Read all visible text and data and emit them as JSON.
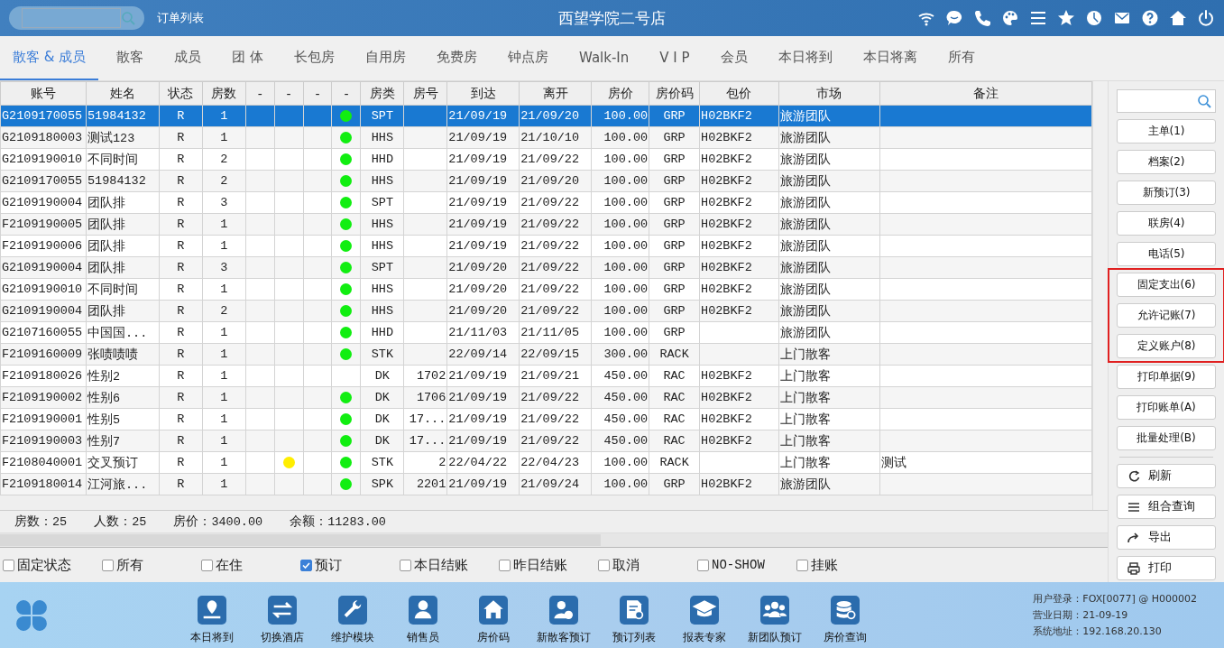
{
  "top_bar": {
    "page_label": "订单列表",
    "title": "西望学院二号店"
  },
  "tabs": [
    {
      "label": "散客 & 成员",
      "selected": true
    },
    {
      "label": "散客",
      "selected": false
    },
    {
      "label": "成员",
      "selected": false
    },
    {
      "label": "团 体",
      "selected": false
    },
    {
      "label": "长包房",
      "selected": false
    },
    {
      "label": "自用房",
      "selected": false
    },
    {
      "label": "免费房",
      "selected": false
    },
    {
      "label": "钟点房",
      "selected": false
    },
    {
      "label": "Walk-In",
      "selected": false
    },
    {
      "label": "V I P",
      "selected": false
    },
    {
      "label": "会员",
      "selected": false
    },
    {
      "label": "本日将到",
      "selected": false
    },
    {
      "label": "本日将离",
      "selected": false
    },
    {
      "label": "所有",
      "selected": false
    }
  ],
  "table": {
    "columns": [
      "账号",
      "姓名",
      "状态",
      "房数",
      "-",
      "-",
      "-",
      "-",
      "房类",
      "房号",
      "到达",
      "离开",
      "房价",
      "房价码",
      "包价",
      "市场",
      "备注"
    ],
    "rows": [
      {
        "account": "G2109170055",
        "name": "51984132",
        "status": "R",
        "rooms": "1",
        "dot": {
          "color": "#11ee11"
        },
        "room_type": "SPT",
        "arrival": "21/09/19",
        "departure": "21/09/20",
        "rate": "100.00",
        "rate_code": "GRP",
        "package": "H02BKF2",
        "market": "旅游团队",
        "selected": true
      },
      {
        "account": "G2109180003",
        "name": "测试123",
        "status": "R",
        "rooms": "1",
        "dot": {
          "color": "#11ee11"
        },
        "room_type": "HHS",
        "arrival": "21/09/19",
        "departure": "21/10/10",
        "rate": "100.00",
        "rate_code": "GRP",
        "package": "H02BKF2",
        "market": "旅游团队",
        "selected": false
      },
      {
        "account": "G2109190010",
        "name": "不同时间",
        "status": "R",
        "rooms": "2",
        "dot": {
          "color": "#11ee11"
        },
        "room_type": "HHD",
        "arrival": "21/09/19",
        "departure": "21/09/22",
        "rate": "100.00",
        "rate_code": "GRP",
        "package": "H02BKF2",
        "market": "旅游团队",
        "selected": false
      },
      {
        "account": "G2109170055",
        "name": "51984132",
        "status": "R",
        "rooms": "2",
        "dot": {
          "color": "#11ee11"
        },
        "room_type": "HHS",
        "arrival": "21/09/19",
        "departure": "21/09/20",
        "rate": "100.00",
        "rate_code": "GRP",
        "package": "H02BKF2",
        "market": "旅游团队",
        "selected": false
      },
      {
        "account": "G2109190004",
        "name": "团队排",
        "status": "R",
        "rooms": "3",
        "dot": {
          "color": "#11ee11"
        },
        "room_type": "SPT",
        "arrival": "21/09/19",
        "departure": "21/09/22",
        "rate": "100.00",
        "rate_code": "GRP",
        "package": "H02BKF2",
        "market": "旅游团队",
        "selected": false
      },
      {
        "account": "F2109190005",
        "name": "团队排",
        "status": "R",
        "rooms": "1",
        "dot": {
          "color": "#11ee11"
        },
        "room_type": "HHS",
        "arrival": "21/09/19",
        "departure": "21/09/22",
        "rate": "100.00",
        "rate_code": "GRP",
        "package": "H02BKF2",
        "market": "旅游团队",
        "selected": false
      },
      {
        "account": "F2109190006",
        "name": "团队排",
        "status": "R",
        "rooms": "1",
        "dot": {
          "color": "#11ee11"
        },
        "room_type": "HHS",
        "arrival": "21/09/19",
        "departure": "21/09/22",
        "rate": "100.00",
        "rate_code": "GRP",
        "package": "H02BKF2",
        "market": "旅游团队",
        "selected": false
      },
      {
        "account": "G2109190004",
        "name": "团队排",
        "status": "R",
        "rooms": "3",
        "dot": {
          "color": "#11ee11"
        },
        "room_type": "SPT",
        "arrival": "21/09/20",
        "departure": "21/09/22",
        "rate": "100.00",
        "rate_code": "GRP",
        "package": "H02BKF2",
        "market": "旅游团队",
        "selected": false
      },
      {
        "account": "G2109190010",
        "name": "不同时间",
        "status": "R",
        "rooms": "1",
        "dot": {
          "color": "#11ee11"
        },
        "room_type": "HHS",
        "arrival": "21/09/20",
        "departure": "21/09/22",
        "rate": "100.00",
        "rate_code": "GRP",
        "package": "H02BKF2",
        "market": "旅游团队",
        "selected": false
      },
      {
        "account": "G2109190004",
        "name": "团队排",
        "status": "R",
        "rooms": "2",
        "dot": {
          "color": "#11ee11"
        },
        "room_type": "HHS",
        "arrival": "21/09/20",
        "departure": "21/09/22",
        "rate": "100.00",
        "rate_code": "GRP",
        "package": "H02BKF2",
        "market": "旅游团队",
        "selected": false
      },
      {
        "account": "G2107160055",
        "name": "中国国...",
        "status": "R",
        "rooms": "1",
        "dot": {
          "color": "#11ee11"
        },
        "room_type": "HHD",
        "arrival": "21/11/03",
        "departure": "21/11/05",
        "rate": "100.00",
        "rate_code": "GRP",
        "market": "旅游团队",
        "selected": false
      },
      {
        "account": "F2109160009",
        "name": "张啧啧啧",
        "status": "R",
        "rooms": "1",
        "dot": {
          "color": "#11ee11"
        },
        "room_type": "STK",
        "arrival": "22/09/14",
        "departure": "22/09/15",
        "rate": "300.00",
        "rate_code": "RACK",
        "market": "上门散客",
        "selected": false
      },
      {
        "account": "F2109180026",
        "name": "性别2",
        "status": "R",
        "rooms": "1",
        "room_type": "DK",
        "room_no": "1702",
        "arrival": "21/09/19",
        "departure": "21/09/21",
        "rate": "450.00",
        "rate_code": "RAC",
        "package": "H02BKF2",
        "market": "上门散客",
        "selected": false
      },
      {
        "account": "F2109190002",
        "name": "性别6",
        "status": "R",
        "rooms": "1",
        "dot": {
          "color": "#11ee11"
        },
        "room_type": "DK",
        "room_no": "1706",
        "arrival": "21/09/19",
        "departure": "21/09/22",
        "rate": "450.00",
        "rate_code": "RAC",
        "package": "H02BKF2",
        "market": "上门散客",
        "selected": false
      },
      {
        "account": "F2109190001",
        "name": "性别5",
        "status": "R",
        "rooms": "1",
        "dot": {
          "color": "#11ee11"
        },
        "room_type": "DK",
        "room_no": "17...",
        "arrival": "21/09/19",
        "departure": "21/09/22",
        "rate": "450.00",
        "rate_code": "RAC",
        "package": "H02BKF2",
        "market": "上门散客",
        "selected": false
      },
      {
        "account": "F2109190003",
        "name": "性别7",
        "status": "R",
        "rooms": "1",
        "dot": {
          "color": "#11ee11"
        },
        "room_type": "DK",
        "room_no": "17...",
        "arrival": "21/09/19",
        "departure": "21/09/22",
        "rate": "450.00",
        "rate_code": "RAC",
        "package": "H02BKF2",
        "market": "上门散客",
        "selected": false
      },
      {
        "account": "F2108040001",
        "name": "交叉预订",
        "status": "R",
        "rooms": "1",
        "flag": {
          "color": "#ffee00"
        },
        "dot": {
          "color": "#11ee11"
        },
        "room_type": "STK",
        "room_no": "2",
        "arrival": "22/04/22",
        "departure": "22/04/23",
        "rate": "100.00",
        "rate_code": "RACK",
        "market": "上门散客",
        "remark": "测试",
        "selected": false
      },
      {
        "account": "F2109180014",
        "name": "江河旅...",
        "status": "R",
        "rooms": "1",
        "dot": {
          "color": "#11ee11"
        },
        "room_type": "SPK",
        "room_no": "2201",
        "arrival": "21/09/19",
        "departure": "21/09/24",
        "rate": "100.00",
        "rate_code": "GRP",
        "package": "H02BKF2",
        "market": "旅游团队",
        "selected": false
      }
    ]
  },
  "summary": [
    "房数：25",
    "人数：25",
    "房价：3400.00",
    "余额：11283.00"
  ],
  "filters": [
    {
      "label": "固定状态",
      "checked": false
    },
    {
      "label": "所有",
      "checked": false
    },
    {
      "label": "在住",
      "checked": false
    },
    {
      "label": "预订",
      "checked": true
    },
    {
      "label": "本日结账",
      "checked": false
    },
    {
      "label": "昨日结账",
      "checked": false
    },
    {
      "label": "取消",
      "checked": false
    },
    {
      "label": "NO-SHOW",
      "checked": false
    },
    {
      "label": "挂账",
      "checked": false
    }
  ],
  "action_groups": [
    {
      "highlighted": false,
      "buttons": [
        "主单(1)",
        "档案(2)",
        "新预订(3)",
        "联房(4)",
        "电话(5)"
      ]
    },
    {
      "highlighted": true,
      "buttons": [
        "固定支出(6)",
        "允许记账(7)",
        "定义账户(8)"
      ]
    },
    {
      "highlighted": false,
      "buttons": [
        "打印单据(9)",
        "打印账单(A)",
        "批量处理(B)"
      ]
    }
  ],
  "tool_buttons": [
    "刷新",
    "组合查询",
    "导出",
    "打印"
  ],
  "dock": [
    "本日将到",
    "切换酒店",
    "维护模块",
    "销售员",
    "房价码",
    "新散客预订",
    "预订列表",
    "报表专家",
    "新团队预订",
    "房价查询"
  ],
  "session": [
    "用户登录：FOX[0077] @ H000002",
    "营业日期：21-09-19",
    "系统地址：192.168.20.130"
  ]
}
